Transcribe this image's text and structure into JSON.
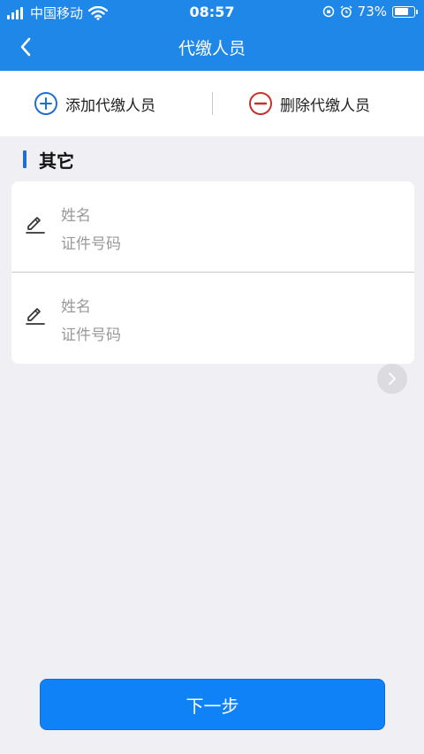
{
  "status_bar": {
    "carrier": "中国移动",
    "time": "08:57",
    "battery_percent": "73%",
    "battery_level": 0.73
  },
  "nav": {
    "title": "代缴人员"
  },
  "actions": {
    "add_label": "添加代缴人员",
    "delete_label": "删除代缴人员",
    "add_color": "#1f6fd1",
    "delete_color": "#c8312b"
  },
  "section": {
    "title": "其它"
  },
  "persons": [
    {
      "name_placeholder": "姓名",
      "id_placeholder": "证件号码"
    },
    {
      "name_placeholder": "姓名",
      "id_placeholder": "证件号码"
    }
  ],
  "next_button": {
    "label": "下一步"
  },
  "icons": {
    "back": "chevron-left-icon",
    "add": "plus-circle-icon",
    "delete": "minus-circle-icon",
    "edit": "pencil-icon",
    "scroll": "chevron-right-icon"
  },
  "colors": {
    "header": "#1f87e8",
    "primary_button": "#0f82f7",
    "background": "#efeff4"
  }
}
